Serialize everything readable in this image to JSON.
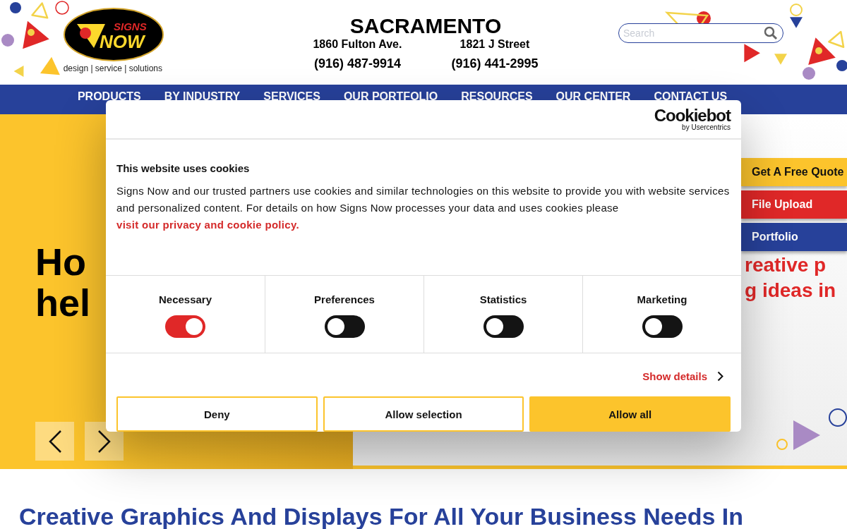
{
  "header": {
    "logo": {
      "top": "SIGNS",
      "bottom": "NOW",
      "tagline": "design | service | solutions"
    },
    "city": "SACRAMENTO",
    "locations": [
      {
        "address": "1860 Fulton Ave.",
        "phone": "(916) 487-9914"
      },
      {
        "address": "1821 J Street",
        "phone": "(916) 441-2995"
      }
    ],
    "search": {
      "placeholder": "Search"
    }
  },
  "nav": [
    "PRODUCTS",
    "BY INDUSTRY",
    "SERVICES",
    "OUR PORTFOLIO",
    "RESOURCES",
    "OUR CENTER",
    "CONTACT US"
  ],
  "hero": {
    "heading": [
      "Ho",
      "hel"
    ],
    "banner_text": [
      "reative p",
      "g ideas in"
    ]
  },
  "side_tabs": [
    {
      "label": "Get A Free Quote",
      "color": "#fcc42c"
    },
    {
      "label": "File Upload",
      "color": "#e02828"
    },
    {
      "label": "Portfolio",
      "color": "#27419a"
    }
  ],
  "cookie_dialog": {
    "brand": "Cookiebot",
    "brand_sub": "by Usercentrics",
    "title": "This website uses cookies",
    "text": "Signs Now and our trusted partners use cookies and similar technologies on this website to provide you with website services and personalized content. For details on how Signs Now processes your data and uses cookies please ",
    "link": "visit our privacy and cookie policy.",
    "categories": [
      {
        "label": "Necessary",
        "on": true
      },
      {
        "label": "Preferences",
        "on": false
      },
      {
        "label": "Statistics",
        "on": false
      },
      {
        "label": "Marketing",
        "on": false
      }
    ],
    "details": "Show details",
    "buttons": [
      {
        "label": "Deny",
        "kind": "outline"
      },
      {
        "label": "Allow selection",
        "kind": "outline"
      },
      {
        "label": "Allow all",
        "kind": "filled"
      }
    ]
  },
  "section_heading": "Creative Graphics And Displays For All Your Business Needs In"
}
